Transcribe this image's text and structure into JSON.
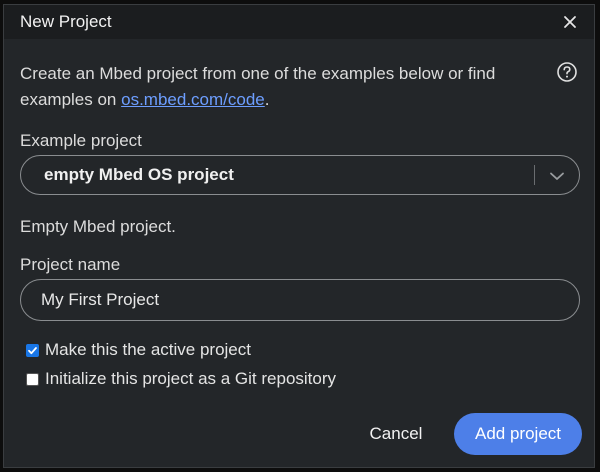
{
  "dialog": {
    "title": "New Project",
    "close_icon": "close-icon"
  },
  "intro": {
    "text_before_link": "Create an Mbed project from one of the examples below or find examples on ",
    "link_text": "os.mbed.com/code",
    "text_after_link": ".",
    "help_icon": "help-circle-icon"
  },
  "example_project": {
    "label": "Example project",
    "selected": "empty Mbed OS project",
    "description": "Empty Mbed project."
  },
  "project_name": {
    "label": "Project name",
    "value": "My First Project"
  },
  "options": [
    {
      "label": "Make this the active project",
      "checked": true
    },
    {
      "label": "Initialize this project as a Git repository",
      "checked": false
    }
  ],
  "buttons": {
    "cancel": "Cancel",
    "add": "Add project"
  },
  "colors": {
    "dialog_bg": "#232629",
    "titlebar_bg": "#1b1d1f",
    "accent": "#4d7fe8",
    "link": "#6d9eff",
    "checkbox_on": "#1976e6"
  }
}
